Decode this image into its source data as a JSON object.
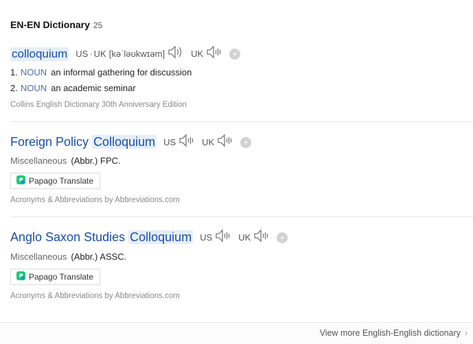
{
  "header": {
    "title": "EN-EN Dictionary",
    "count": "25"
  },
  "entries": [
    {
      "word": "colloquium",
      "us_label": "US",
      "sep": "·",
      "uk_label": "UK",
      "phonetic": "[kəˈləʊkwɪəm]",
      "uk_label2": "UK",
      "definitions": [
        {
          "num": "1.",
          "pos": "NOUN",
          "text": "an informal gathering for discussion"
        },
        {
          "num": "2.",
          "pos": "NOUN",
          "text": "an academic seminar"
        }
      ],
      "source": "Collins English Dictionary 30th Anniversary Edition"
    },
    {
      "title_prefix": "Foreign Policy",
      "title_highlight": "Colloquium",
      "us_label": "US",
      "uk_label": "UK",
      "category": "Miscellaneous",
      "abbr": "(Abbr.) FPC.",
      "translate_label": "Papago Translate",
      "source": "Acronyms & Abbreviations by Abbreviations.com"
    },
    {
      "title_prefix": "Anglo Saxon Studies",
      "title_highlight": "Colloquium",
      "us_label": "US",
      "uk_label": "UK",
      "category": "Miscellaneous",
      "abbr": "(Abbr.) ASSC.",
      "translate_label": "Papago Translate",
      "source": "Acronyms & Abbreviations by Abbreviations.com"
    }
  ],
  "footer": {
    "link": "View more English-English dictionary"
  },
  "icons": {
    "speaker": "speaker-icon",
    "add": "plus-circle-icon",
    "papago": "papago-logo-icon",
    "chevron": "chevron-right-icon"
  },
  "colors": {
    "link_blue": "#1b4fa3",
    "highlight": "#e4eef9",
    "pos_blue": "#4a6fa5"
  }
}
